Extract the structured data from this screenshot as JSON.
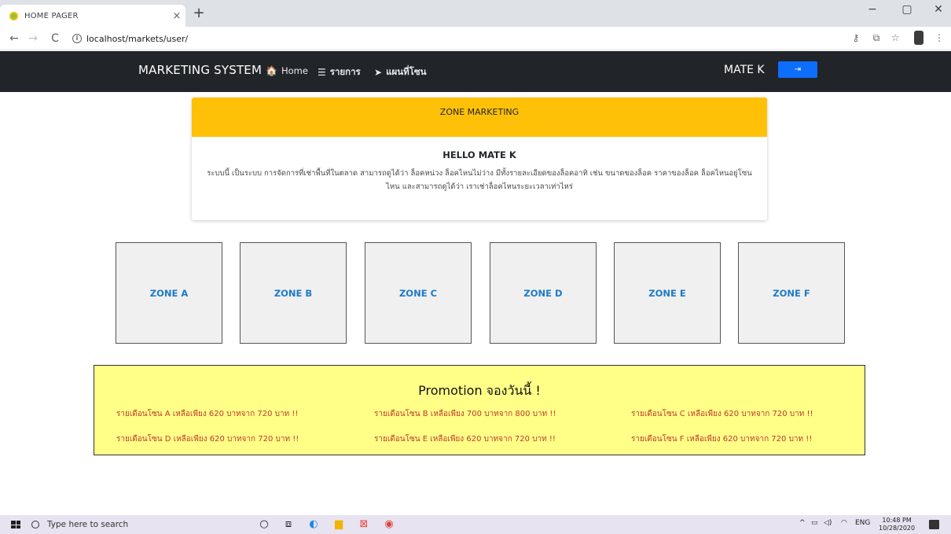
{
  "browser": {
    "tab_title": "HOME PAGER",
    "tab_close": "×",
    "new_tab": "+",
    "url": "localhost/markets/user/",
    "controls": {
      "minimize": "−",
      "maximize": "▢",
      "close": "✕"
    },
    "nav": {
      "back": "←",
      "forward": "→",
      "reload": "C"
    }
  },
  "navbar": {
    "brand": "MARKETING SYSTEM",
    "links": [
      {
        "icon": "home-icon",
        "glyph": "🏠",
        "label": "Home"
      },
      {
        "icon": "list-icon",
        "glyph": "☰",
        "label": "รายการ"
      },
      {
        "icon": "location-arrow-icon",
        "glyph": "➤",
        "label": "แผนที่โซน"
      }
    ],
    "user": "MATE K",
    "logout_glyph": "⇥"
  },
  "card": {
    "header": "ZONE MARKETING",
    "title": "HELLO MATE K",
    "text": "ระบบนี้ เป็นระบบ การจัดการที่เช่าพื้นที่ในตลาด สามารถดูได้ว่า ล็อคหน่วง ล็อคไหนไม่ว่าง มีทั้งรายละเอียดของล็อคอาทิ เช่น ขนาดของล็อค ราคาของล็อค ล็อคไหนอยู่โซนไหน และสามารถดูได้ว่า เราเช่าล็อคไหนระยะเวลาเท่าไหร่"
  },
  "zones": [
    "ZONE A",
    "ZONE B",
    "ZONE C",
    "ZONE D",
    "ZONE E",
    "ZONE F"
  ],
  "promotion": {
    "title": "Promotion จองวันนี้ !",
    "items": [
      "รายเดือนโซน A เหลือเพียง 620 บาทจาก 720 บาท !!",
      "รายเดือนโซน B เหลือเพียง 700 บาทจาก 800 บาท !!",
      "รายเดือนโซน C เหลือเพียง 620 บาทจาก 720 บาท !!",
      "รายเดือนโซน D เหลือเพียง 620 บาทจาก 720 บาท !!",
      "รายเดือนโซน E เหลือเพียง 620 บาทจาก 720 บาท !!",
      "รายเดือนโซน F เหลือเพียง 620 บาทจาก 720 บาท !!"
    ]
  },
  "taskbar": {
    "search_placeholder": "Type here to search",
    "language": "ENG",
    "time": "10:48 PM",
    "date": "10/28/2020"
  },
  "colors": {
    "navbar_bg": "#212529",
    "card_header": "#ffc107",
    "zone_label": "#1e7ac8",
    "promo_bg": "#ffff88",
    "promo_text": "#c0392b",
    "logout_btn": "#0d6efd"
  }
}
